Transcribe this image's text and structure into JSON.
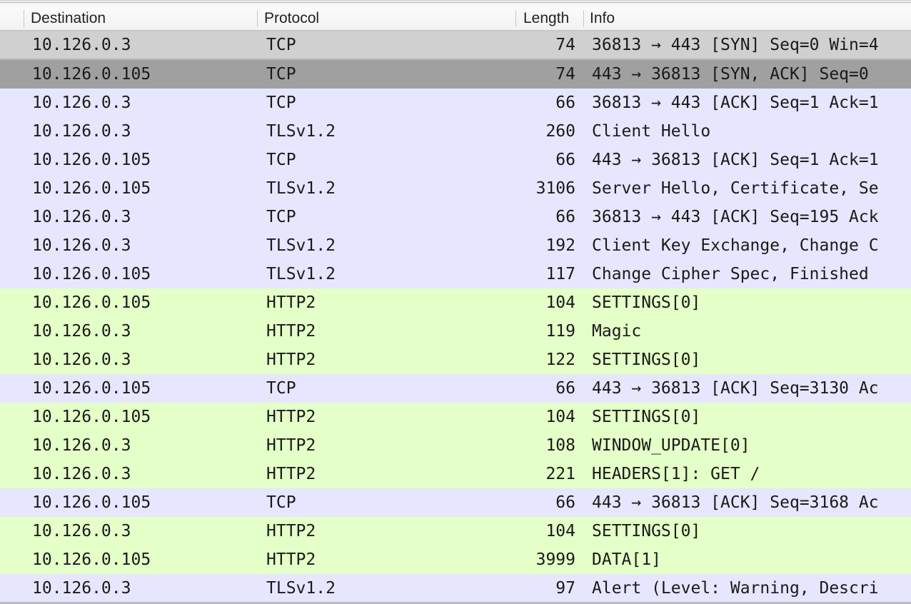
{
  "columns": {
    "destination": "Destination",
    "protocol": "Protocol",
    "length": "Length",
    "info": "Info"
  },
  "colors": {
    "tcp_row_bg": "#e7e6ff",
    "http2_row_bg": "#e4ffc7",
    "syn_row_bg": "#d0d0d0",
    "selected_row_bg": "#a0a0a0"
  },
  "packets": [
    {
      "destination": "10.126.0.3",
      "protocol": "TCP",
      "length": "74",
      "info": "36813 → 443 [SYN] Seq=0 Win=4",
      "kind": "syn"
    },
    {
      "destination": "10.126.0.105",
      "protocol": "TCP",
      "length": "74",
      "info": "443 → 36813 [SYN, ACK] Seq=0 ",
      "kind": "synack"
    },
    {
      "destination": "10.126.0.3",
      "protocol": "TCP",
      "length": "66",
      "info": "36813 → 443 [ACK] Seq=1 Ack=1",
      "kind": "tcp"
    },
    {
      "destination": "10.126.0.3",
      "protocol": "TLSv1.2",
      "length": "260",
      "info": "Client Hello",
      "kind": "tls"
    },
    {
      "destination": "10.126.0.105",
      "protocol": "TCP",
      "length": "66",
      "info": "443 → 36813 [ACK] Seq=1 Ack=1",
      "kind": "tcp"
    },
    {
      "destination": "10.126.0.105",
      "protocol": "TLSv1.2",
      "length": "3106",
      "info": "Server Hello, Certificate, Se",
      "kind": "tls"
    },
    {
      "destination": "10.126.0.3",
      "protocol": "TCP",
      "length": "66",
      "info": "36813 → 443 [ACK] Seq=195 Ack",
      "kind": "tcp"
    },
    {
      "destination": "10.126.0.3",
      "protocol": "TLSv1.2",
      "length": "192",
      "info": "Client Key Exchange, Change C",
      "kind": "tls"
    },
    {
      "destination": "10.126.0.105",
      "protocol": "TLSv1.2",
      "length": "117",
      "info": "Change Cipher Spec, Finished",
      "kind": "tls"
    },
    {
      "destination": "10.126.0.105",
      "protocol": "HTTP2",
      "length": "104",
      "info": "SETTINGS[0]",
      "kind": "http2"
    },
    {
      "destination": "10.126.0.3",
      "protocol": "HTTP2",
      "length": "119",
      "info": "Magic",
      "kind": "http2"
    },
    {
      "destination": "10.126.0.3",
      "protocol": "HTTP2",
      "length": "122",
      "info": "SETTINGS[0]",
      "kind": "http2"
    },
    {
      "destination": "10.126.0.105",
      "protocol": "TCP",
      "length": "66",
      "info": "443 → 36813 [ACK] Seq=3130 Ac",
      "kind": "tcp"
    },
    {
      "destination": "10.126.0.105",
      "protocol": "HTTP2",
      "length": "104",
      "info": "SETTINGS[0]",
      "kind": "http2"
    },
    {
      "destination": "10.126.0.3",
      "protocol": "HTTP2",
      "length": "108",
      "info": "WINDOW_UPDATE[0]",
      "kind": "http2"
    },
    {
      "destination": "10.126.0.3",
      "protocol": "HTTP2",
      "length": "221",
      "info": "HEADERS[1]: GET /",
      "kind": "http2"
    },
    {
      "destination": "10.126.0.105",
      "protocol": "TCP",
      "length": "66",
      "info": "443 → 36813 [ACK] Seq=3168 Ac",
      "kind": "tcp"
    },
    {
      "destination": "10.126.0.3",
      "protocol": "HTTP2",
      "length": "104",
      "info": "SETTINGS[0]",
      "kind": "http2"
    },
    {
      "destination": "10.126.0.105",
      "protocol": "HTTP2",
      "length": "3999",
      "info": "DATA[1]",
      "kind": "http2"
    },
    {
      "destination": "10.126.0.3",
      "protocol": "TLSv1.2",
      "length": "97",
      "info": "Alert (Level: Warning, Descri",
      "kind": "tls"
    }
  ]
}
